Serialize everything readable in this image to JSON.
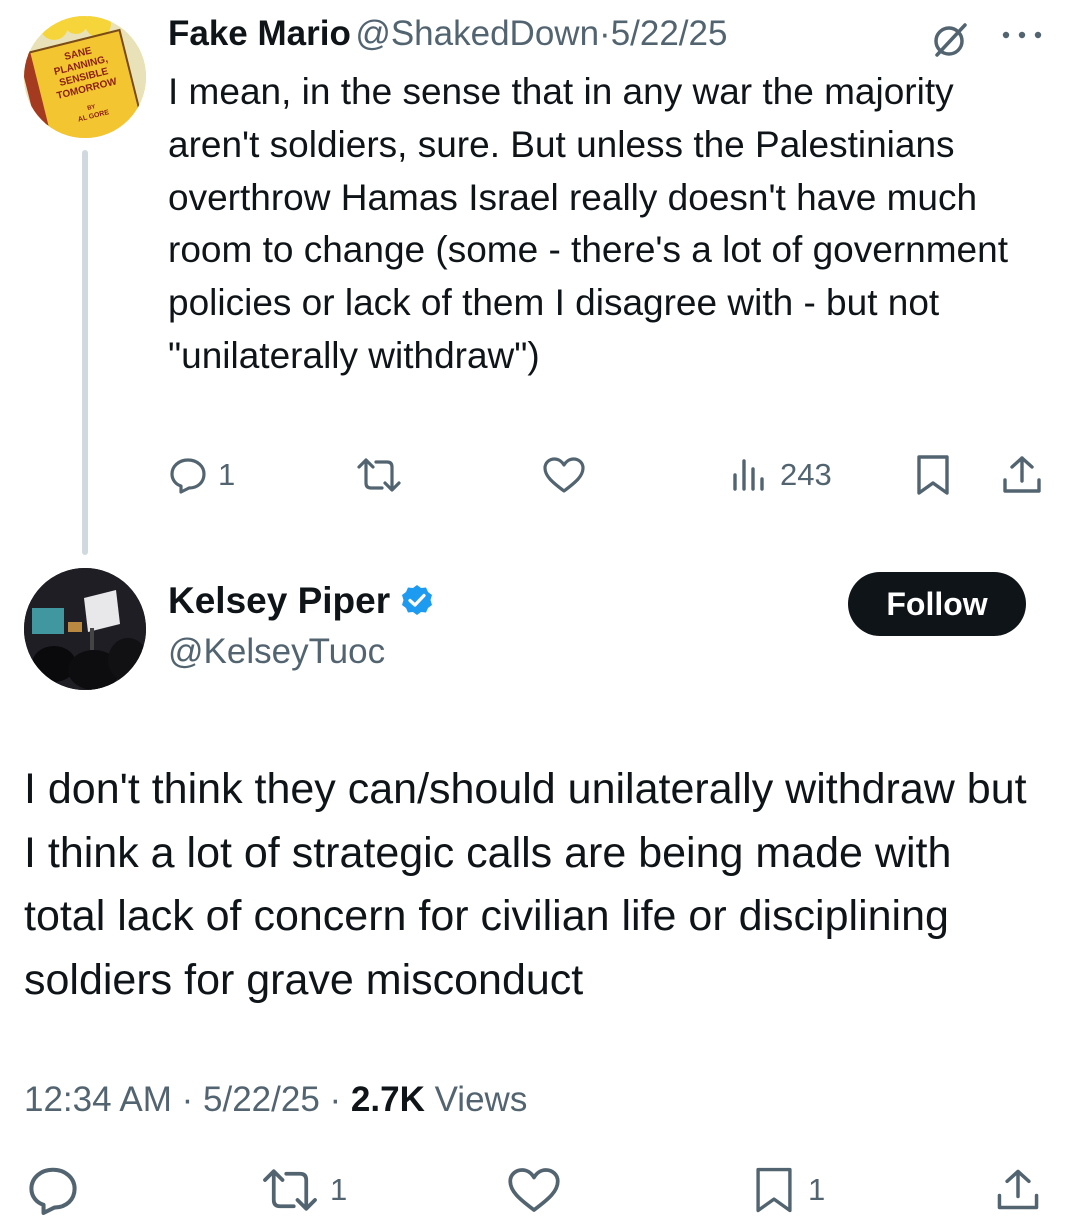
{
  "reply_tweet": {
    "author_name": "Fake Mario",
    "author_handle": "@ShakedDown",
    "separator": "·",
    "date": "5/22/25",
    "avatar_text": [
      "SANE",
      "PLANNING,",
      "SENSIBLE",
      "TOMORROW",
      "BY",
      "AL GORE"
    ],
    "body": "I mean, in the sense that in any war the majority aren't soldiers, sure. But unless the Palestinians overthrow Hamas Israel really doesn't have much room to change (some - there's a lot of government policies or lack of them I disagree with - but not \"unilaterally withdraw\")",
    "reply_count": "1",
    "views_count": "243",
    "icons": [
      "grok-icon",
      "more-icon",
      "reply-icon",
      "retweet-icon",
      "like-icon",
      "views-icon",
      "bookmark-icon",
      "share-icon"
    ]
  },
  "main_tweet": {
    "author_name": "Kelsey Piper",
    "author_handle": "@KelseyTuoc",
    "verified": true,
    "follow_label": "Follow",
    "body": "I don't think they can/should unilaterally withdraw but I think a lot of strategic calls are being made with total lack of concern for civilian life or disciplining soldiers for grave misconduct",
    "time": "12:34 AM",
    "separator": "·",
    "date": "5/22/25",
    "views_count": "2.7K",
    "views_label": "Views",
    "retweet_count": "1",
    "bookmark_count": "1"
  },
  "colors": {
    "text": "#0f1419",
    "muted": "#536471",
    "verified": "#1d9bf0",
    "follow_bg": "#0f1419",
    "thread_line": "#cfd9de"
  }
}
